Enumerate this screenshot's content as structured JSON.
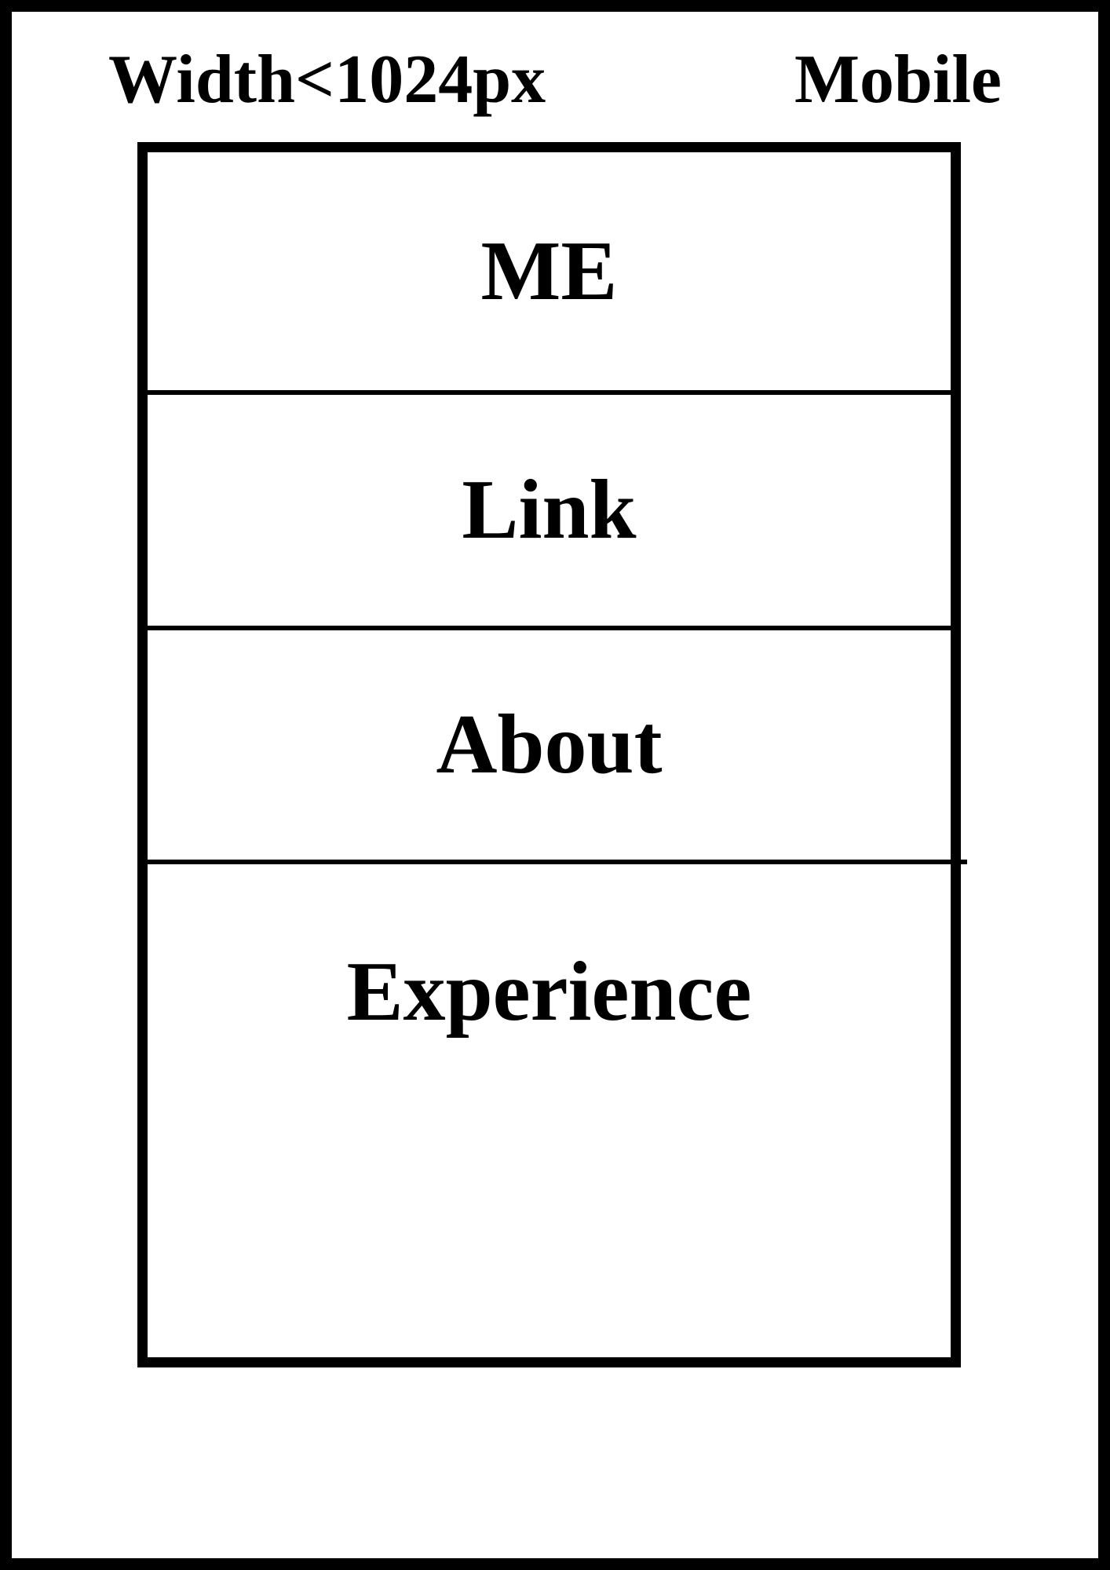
{
  "header": {
    "breakpoint": "Width<1024px",
    "device": "Mobile"
  },
  "sections": [
    "ME",
    "Link",
    "About",
    "Experience"
  ],
  "colors": {
    "stroke": "#000000",
    "background": "#ffffff"
  }
}
